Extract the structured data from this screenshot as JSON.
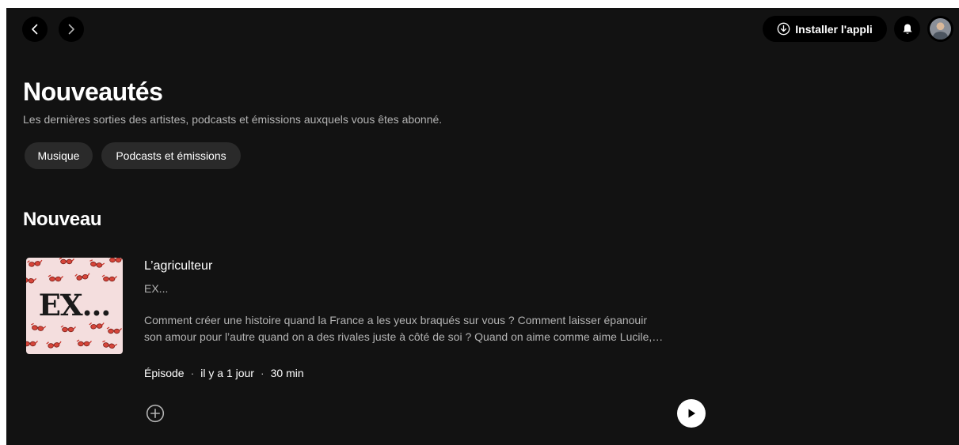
{
  "header": {
    "install_label": "Installer l'appli"
  },
  "page": {
    "title": "Nouveautés",
    "subtitle": "Les dernières sorties des artistes, podcasts et émissions auxquels vous êtes abonné."
  },
  "filters": [
    {
      "label": "Musique"
    },
    {
      "label": "Podcasts et émissions"
    }
  ],
  "section": {
    "title": "Nouveau"
  },
  "episode": {
    "cover_text": "EX...",
    "title": "L’agriculteur",
    "show": "EX...",
    "description_line1": "Comment créer une histoire quand la France a les yeux braqués sur vous ? Comment laisser épanouir",
    "description_line2": "son amour pour l’autre quand on a des rivales juste à côté de soi ? Quand on aime comme aime Lucile,…",
    "type": "Épisode",
    "date": "il y a 1 jour",
    "duration": "30 min",
    "separator": "·"
  },
  "icons": {
    "back": "chevron-left-icon",
    "forward": "chevron-right-icon",
    "install": "download-circle-icon",
    "bell": "bell-icon",
    "add": "add-circle-icon",
    "play": "play-icon",
    "sunglasses": "sunglasses-icon"
  },
  "colors": {
    "background": "#121212",
    "chip": "#2a2a2a",
    "text_secondary": "#b3b3b3",
    "cover_bg": "#f4dede",
    "sunglasses": "#d6453a"
  }
}
